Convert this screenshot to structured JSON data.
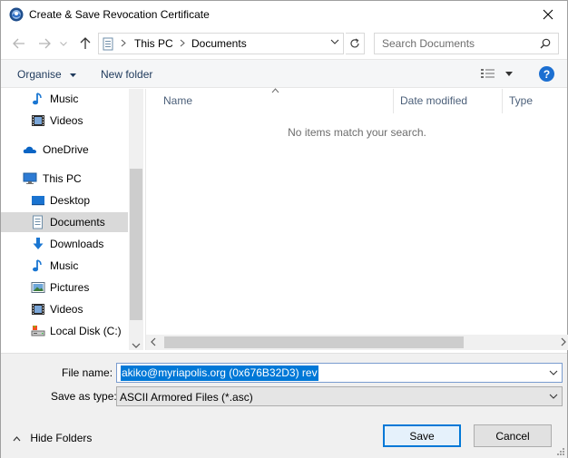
{
  "window": {
    "title": "Create & Save Revocation Certificate"
  },
  "address": {
    "crumbs": [
      "This PC",
      "Documents"
    ]
  },
  "search": {
    "placeholder": "Search Documents"
  },
  "toolbar": {
    "organise_label": "Organise",
    "new_folder_label": "New folder",
    "help_label": "?"
  },
  "navpane": {
    "items": [
      {
        "label": "Music",
        "icon": "music-icon"
      },
      {
        "label": "Videos",
        "icon": "videos-icon"
      },
      {
        "label": "OneDrive",
        "icon": "onedrive-icon"
      },
      {
        "label": "This PC",
        "icon": "this-pc-icon"
      },
      {
        "label": "Desktop",
        "icon": "desktop-icon"
      },
      {
        "label": "Documents",
        "icon": "documents-icon",
        "selected": true
      },
      {
        "label": "Downloads",
        "icon": "downloads-icon"
      },
      {
        "label": "Music",
        "icon": "music-icon"
      },
      {
        "label": "Pictures",
        "icon": "pictures-icon"
      },
      {
        "label": "Videos",
        "icon": "videos-icon"
      },
      {
        "label": "Local Disk (C:)",
        "icon": "local-disk-icon"
      }
    ]
  },
  "filelist": {
    "columns": [
      "Name",
      "Date modified",
      "Type"
    ],
    "empty_message": "No items match your search."
  },
  "form": {
    "file_name_label": "File name:",
    "file_name_value": "akiko@myriapolis.org (0x676B32D3) rev",
    "save_as_type_label": "Save as type:",
    "save_as_type_value": "ASCII Armored Files (*.asc)"
  },
  "footer": {
    "hide_folders_label": "Hide Folders",
    "save_label": "Save",
    "cancel_label": "Cancel"
  },
  "colors": {
    "accent": "#0078d7",
    "selection_bg": "#d9d9d9",
    "toolbar_text": "#1e395b"
  }
}
